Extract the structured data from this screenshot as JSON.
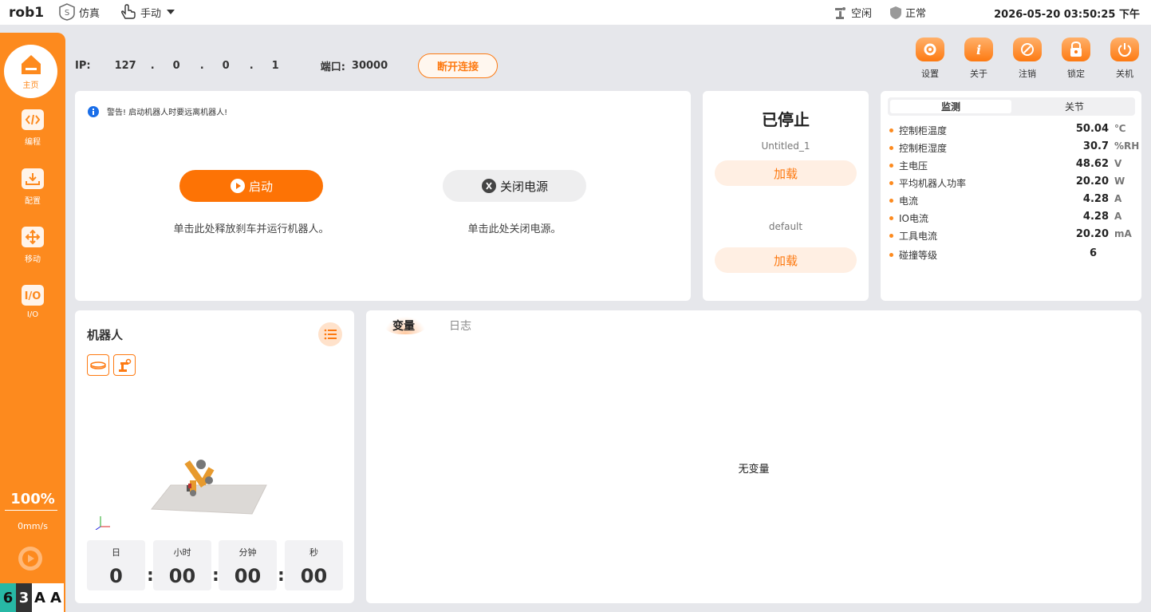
{
  "topbar": {
    "robot_name": "rob1",
    "sim_label": "仿真",
    "mode_label": "手动",
    "robot_status": "空闲",
    "safety_status": "正常",
    "datetime": "2026-05-20 03:50:25 下午"
  },
  "sidebar": {
    "items": [
      {
        "label": "主页",
        "icon": "home-icon"
      },
      {
        "label": "编程",
        "icon": "code-icon"
      },
      {
        "label": "配置",
        "icon": "download-icon"
      },
      {
        "label": "移动",
        "icon": "move-icon"
      },
      {
        "label": "I/O",
        "icon": "io-icon"
      }
    ],
    "speed_percent": "100%",
    "speed_mm": "0mm/s",
    "badges": [
      "6",
      "3",
      "A",
      "A"
    ]
  },
  "connection": {
    "ip_label": "IP:",
    "ip_parts": [
      "127",
      "0",
      "0",
      "1"
    ],
    "port_label": "端口:",
    "port_value": "30000",
    "disconnect_label": "断开连接"
  },
  "toolbar": {
    "settings": "设置",
    "about": "关于",
    "logout": "注销",
    "lock": "锁定",
    "shutdown": "关机"
  },
  "control": {
    "warning": "警告! 启动机器人时要远离机器人!",
    "start_label": "启动",
    "start_hint": "单击此处释放刹车并运行机器人。",
    "power_label": "关闭电源",
    "power_hint": "单击此处关闭电源。"
  },
  "program": {
    "state": "已停止",
    "program_name": "Untitled_1",
    "load_label_1": "加载",
    "config_name": "default",
    "load_label_2": "加载"
  },
  "monitor": {
    "tab_monitor": "监测",
    "tab_joints": "关节",
    "rows": [
      {
        "label": "控制柜温度",
        "value": "50.04",
        "unit": "℃"
      },
      {
        "label": "控制柜湿度",
        "value": "30.7",
        "unit": "%RH"
      },
      {
        "label": "主电压",
        "value": "48.62",
        "unit": "V"
      },
      {
        "label": "平均机器人功率",
        "value": "20.20",
        "unit": "W"
      },
      {
        "label": "电流",
        "value": "4.28",
        "unit": "A"
      },
      {
        "label": "IO电流",
        "value": "4.28",
        "unit": "A"
      },
      {
        "label": "工具电流",
        "value": "20.20",
        "unit": "mA"
      },
      {
        "label": "碰撞等级",
        "value": "6",
        "unit": ""
      }
    ]
  },
  "robot_panel": {
    "title": "机器人",
    "timer": {
      "day_label": "日",
      "day": "0",
      "hour_label": "小时",
      "hour": "00",
      "minute_label": "分钟",
      "minute": "00",
      "second_label": "秒",
      "second": "00"
    }
  },
  "variables": {
    "tab_variables": "变量",
    "tab_log": "日志",
    "empty_message": "无变量"
  }
}
